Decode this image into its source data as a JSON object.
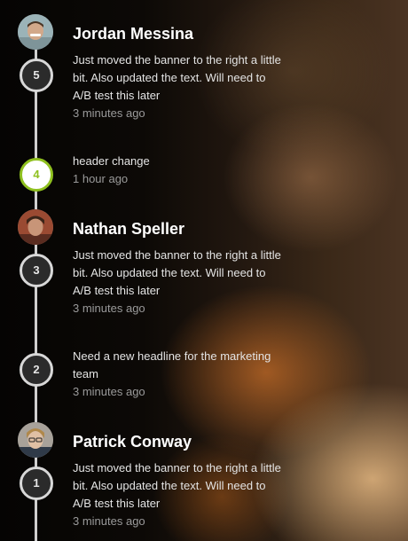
{
  "timeline": {
    "items": [
      {
        "number": "5",
        "author": "Jordan Messina",
        "message": "Just moved the banner to the right a little bit. Also updated the text. Will need to A/B test this later",
        "time": "3 minutes ago",
        "has_avatar": true,
        "active": false
      },
      {
        "number": "4",
        "message": "header change",
        "time": "1 hour ago",
        "has_avatar": false,
        "active": true
      },
      {
        "number": "3",
        "author": "Nathan Speller",
        "message": "Just moved the banner to the right a little bit. Also updated the text. Will need to A/B test this later",
        "time": "3 minutes ago",
        "has_avatar": true,
        "active": false
      },
      {
        "number": "2",
        "message": "Need a new headline for the marketing team",
        "time": "3 minutes ago",
        "has_avatar": false,
        "active": false
      },
      {
        "number": "1",
        "author": "Patrick Conway",
        "message": "Just moved the banner to the right a little bit. Also updated the text. Will need to A/B test this later",
        "time": "3 minutes ago",
        "has_avatar": true,
        "active": false
      }
    ]
  },
  "colors": {
    "active_accent": "#8fc01f",
    "node_border": "#d8d8d8",
    "line": "#cfcfcf"
  }
}
